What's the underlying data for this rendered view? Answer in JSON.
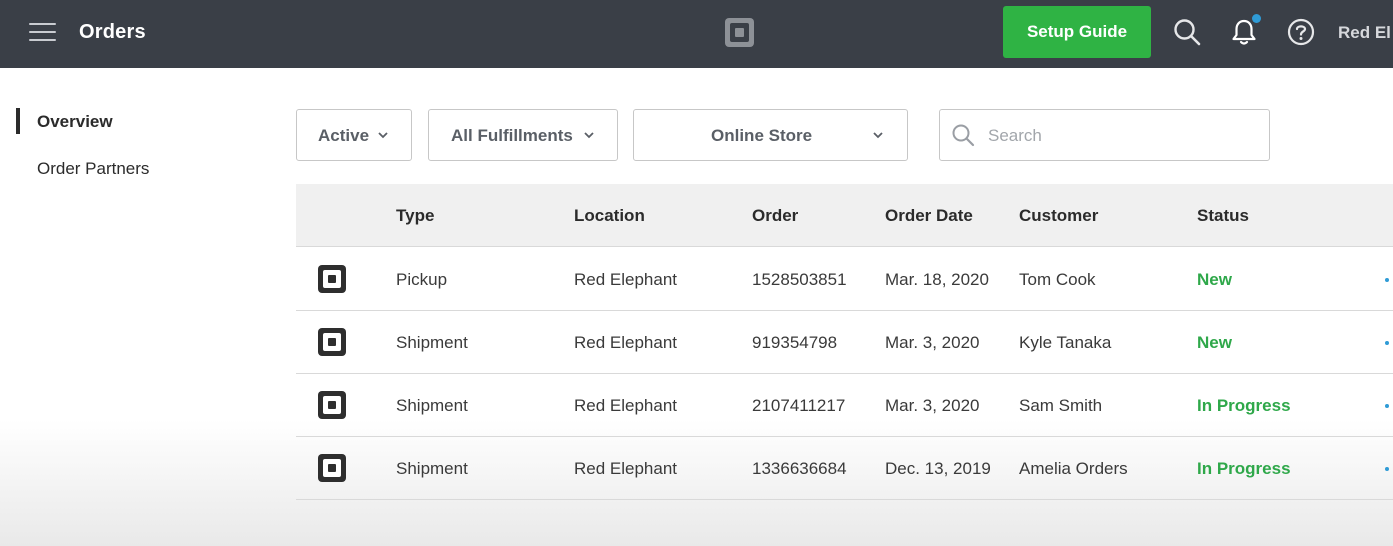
{
  "header": {
    "title": "Orders",
    "setup_button": "Setup Guide",
    "account": "Red El",
    "icons": [
      "menu-icon",
      "square-logo-icon",
      "search-icon",
      "bell-icon",
      "help-icon"
    ],
    "notification_dot_color": "#2f9bd6"
  },
  "sidebar": {
    "items": [
      {
        "label": "Overview",
        "active": true
      },
      {
        "label": "Order Partners",
        "active": false
      }
    ]
  },
  "filters": {
    "status": "Active",
    "fulfillment": "All Fulfillments",
    "channel": "Online Store",
    "search_placeholder": "Search"
  },
  "table": {
    "columns": [
      "Type",
      "Location",
      "Order",
      "Order Date",
      "Customer",
      "Status"
    ],
    "rows": [
      {
        "type": "Pickup",
        "location": "Red Elephant",
        "order": "1528503851",
        "date": "Mar. 18, 2020",
        "customer": "Tom Cook",
        "status": "New"
      },
      {
        "type": "Shipment",
        "location": "Red Elephant",
        "order": "919354798",
        "date": "Mar. 3, 2020",
        "customer": "Kyle Tanaka",
        "status": "New"
      },
      {
        "type": "Shipment",
        "location": "Red Elephant",
        "order": "2107411217",
        "date": "Mar. 3, 2020",
        "customer": "Sam Smith",
        "status": "In Progress"
      },
      {
        "type": "Shipment",
        "location": "Red Elephant",
        "order": "1336636684",
        "date": "Dec. 13, 2019",
        "customer": "Amelia Orders",
        "status": "In Progress"
      }
    ]
  },
  "colors": {
    "topbar": "#3a3f47",
    "accent_green": "#2fb344",
    "status_green": "#2fa84a"
  }
}
